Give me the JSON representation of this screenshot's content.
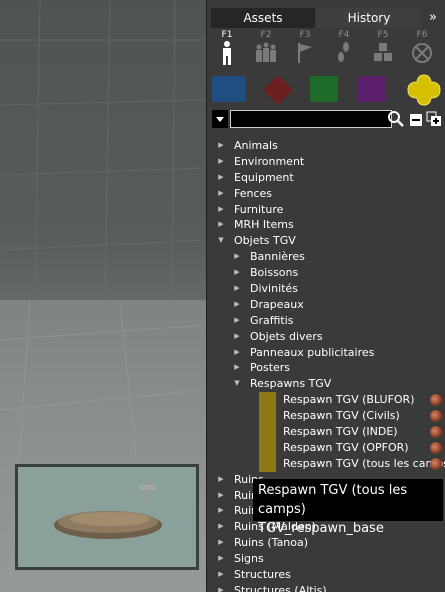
{
  "panel": {
    "tabs": [
      {
        "label": "Assets",
        "active": true
      },
      {
        "label": "History",
        "active": false
      },
      {
        "label": "»",
        "active": false
      }
    ],
    "fkeys": [
      {
        "label": "F1",
        "icon": "person-icon",
        "active": true
      },
      {
        "label": "F2",
        "icon": "group-icon",
        "active": false
      },
      {
        "label": "F3",
        "icon": "flag-icon",
        "active": false
      },
      {
        "label": "F4",
        "icon": "footprints-icon",
        "active": false
      },
      {
        "label": "F5",
        "icon": "boxes-icon",
        "active": false
      },
      {
        "label": "F6",
        "icon": "no-entry-icon",
        "active": false
      }
    ],
    "sides": [
      {
        "name": "blufor",
        "color": "#1f4e80"
      },
      {
        "name": "opfor",
        "color": "#6b1f1f"
      },
      {
        "name": "independent",
        "color": "#1f6b2a"
      },
      {
        "name": "civilian",
        "color": "#5b1f6b"
      },
      {
        "name": "empty",
        "color": "#d4c000"
      }
    ],
    "search": {
      "value": "",
      "placeholder": ""
    }
  },
  "tree": [
    {
      "label": "Animals"
    },
    {
      "label": "Environment"
    },
    {
      "label": "Equipment"
    },
    {
      "label": "Fences"
    },
    {
      "label": "Furniture"
    },
    {
      "label": "MRH Items"
    },
    {
      "label": "Objets TGV",
      "expanded": true
    },
    {
      "label": "Bannières"
    },
    {
      "label": "Boissons"
    },
    {
      "label": "Divinités"
    },
    {
      "label": "Drapeaux"
    },
    {
      "label": "Graffitis"
    },
    {
      "label": "Objets divers"
    },
    {
      "label": "Panneaux publicitaires"
    },
    {
      "label": "Posters"
    },
    {
      "label": "Respawns TGV",
      "expanded": true
    },
    {
      "label": "Respawn TGV (BLUFOR)"
    },
    {
      "label": "Respawn TGV (Civils)"
    },
    {
      "label": "Respawn TGV (INDE)"
    },
    {
      "label": "Respawn TGV (OPFOR)"
    },
    {
      "label": "Respawn TGV (tous les camps)"
    },
    {
      "label": "Ruins"
    },
    {
      "label": "Ruins"
    },
    {
      "label": "Ruins"
    },
    {
      "label": "Ruins (Malden)"
    },
    {
      "label": "Ruins (Tanoa)"
    },
    {
      "label": "Signs"
    },
    {
      "label": "Structures"
    },
    {
      "label": "Structures (Altis)"
    }
  ],
  "tooltip": {
    "title": "Respawn TGV (tous les camps)",
    "classname": "TGV_respawn_base"
  }
}
